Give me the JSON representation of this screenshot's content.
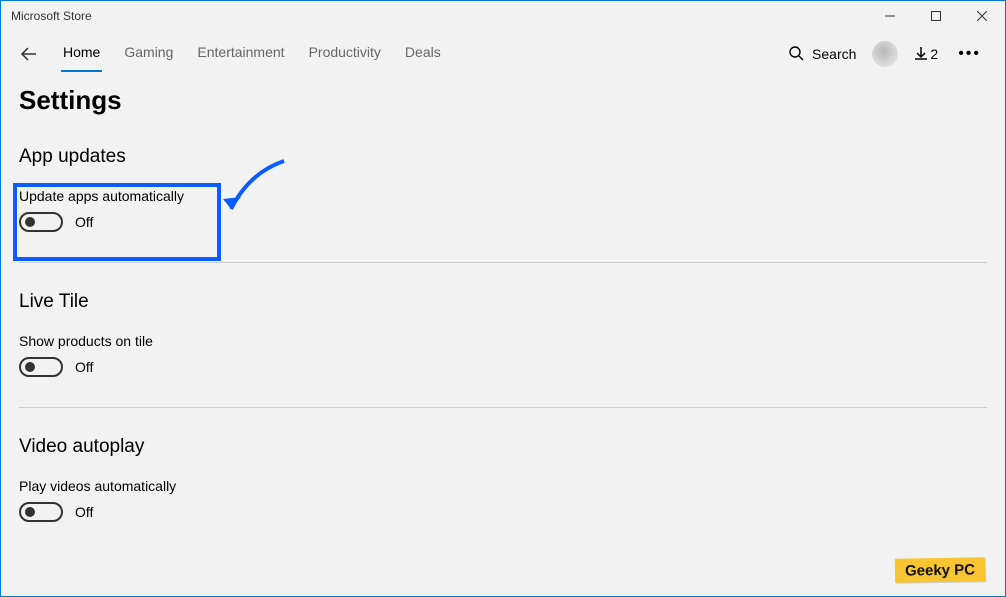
{
  "window": {
    "title": "Microsoft Store"
  },
  "nav": {
    "tabs": [
      {
        "label": "Home",
        "active": true
      },
      {
        "label": "Gaming",
        "active": false
      },
      {
        "label": "Entertainment",
        "active": false
      },
      {
        "label": "Productivity",
        "active": false
      },
      {
        "label": "Deals",
        "active": false
      }
    ],
    "search_label": "Search",
    "downloads_count": "2"
  },
  "page": {
    "title": "Settings",
    "sections": {
      "app_updates": {
        "heading": "App updates",
        "setting_label": "Update apps automatically",
        "state": "Off"
      },
      "live_tile": {
        "heading": "Live Tile",
        "setting_label": "Show products on tile",
        "state": "Off"
      },
      "video_autoplay": {
        "heading": "Video autoplay",
        "setting_label": "Play videos automatically",
        "state": "Off"
      }
    }
  },
  "watermark": {
    "text": "Geeky PC"
  }
}
